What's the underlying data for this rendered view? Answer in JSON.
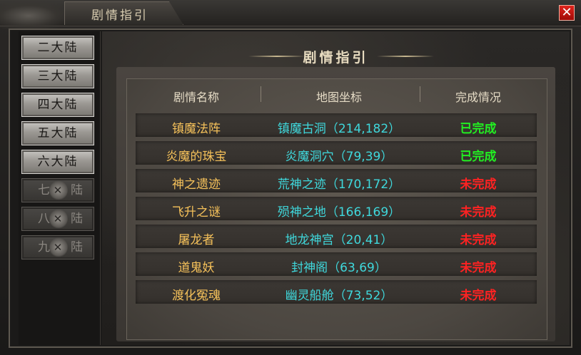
{
  "window": {
    "title": "剧情指引",
    "close_label": "✕"
  },
  "sidebar": {
    "items": [
      {
        "label": "二大陆",
        "locked": false
      },
      {
        "label": "三大陆",
        "locked": false
      },
      {
        "label": "四大陆",
        "locked": false
      },
      {
        "label": "五大陆",
        "locked": false
      },
      {
        "label": "六大陆",
        "locked": false
      },
      {
        "label": "七",
        "label2": "陆",
        "locked": true
      },
      {
        "label": "八",
        "label2": "陆",
        "locked": true
      },
      {
        "label": "九",
        "label2": "陆",
        "locked": true
      }
    ]
  },
  "main": {
    "header": "剧情指引",
    "columns": [
      "剧情名称",
      "地图坐标",
      "完成情况"
    ],
    "rows": [
      {
        "name": "镇魔法阵",
        "map": "镇魔古洞（214,182）",
        "status": "已完成",
        "done": true
      },
      {
        "name": "炎魔的珠宝",
        "map": "炎魔洞穴（79,39）",
        "status": "已完成",
        "done": true
      },
      {
        "name": "神之遗迹",
        "map": "荒神之迹（170,172）",
        "status": "未完成",
        "done": false
      },
      {
        "name": "飞升之谜",
        "map": "殒神之地（166,169）",
        "status": "未完成",
        "done": false
      },
      {
        "name": "屠龙者",
        "map": "地龙神宫（20,41）",
        "status": "未完成",
        "done": false
      },
      {
        "name": "道鬼妖",
        "map": "封神阁（63,69）",
        "status": "未完成",
        "done": false
      },
      {
        "name": "渡化冤魂",
        "map": "幽灵船舱（73,52）",
        "status": "未完成",
        "done": false
      }
    ]
  },
  "colors": {
    "done": "#22ee22",
    "todo": "#ff2222",
    "name": "#f5c15a",
    "map": "#3fd8dc"
  }
}
